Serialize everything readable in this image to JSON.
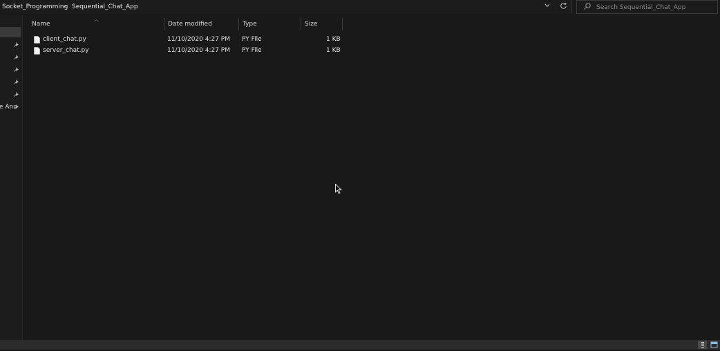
{
  "address_bar": {
    "breadcrumb": [
      "Socket_Programming",
      "Sequential_Chat_App"
    ],
    "separator": "›",
    "dropdown_icon": "chevron-down-icon",
    "refresh_icon": "refresh-icon"
  },
  "search": {
    "placeholder": "Search Sequential_Chat_App",
    "icon": "search-icon"
  },
  "nav_pane": {
    "partial_label": "e Anc",
    "pin_icon": "pin-icon"
  },
  "columns": {
    "name": "Name",
    "date_modified": "Date modified",
    "type": "Type",
    "size": "Size"
  },
  "files": [
    {
      "name": "client_chat.py",
      "date_modified": "11/10/2020 4:27 PM",
      "type": "PY File",
      "size": "1 KB"
    },
    {
      "name": "server_chat.py",
      "date_modified": "11/10/2020 4:27 PM",
      "type": "PY File",
      "size": "1 KB"
    }
  ],
  "status_bar": {
    "view_buttons": [
      "details-view-icon",
      "large-icons-view-icon"
    ]
  },
  "colors": {
    "background": "#191919",
    "text": "#e6e6e6",
    "status_bar": "#2b2b2b",
    "selected_nav": "#3a3a3a"
  }
}
